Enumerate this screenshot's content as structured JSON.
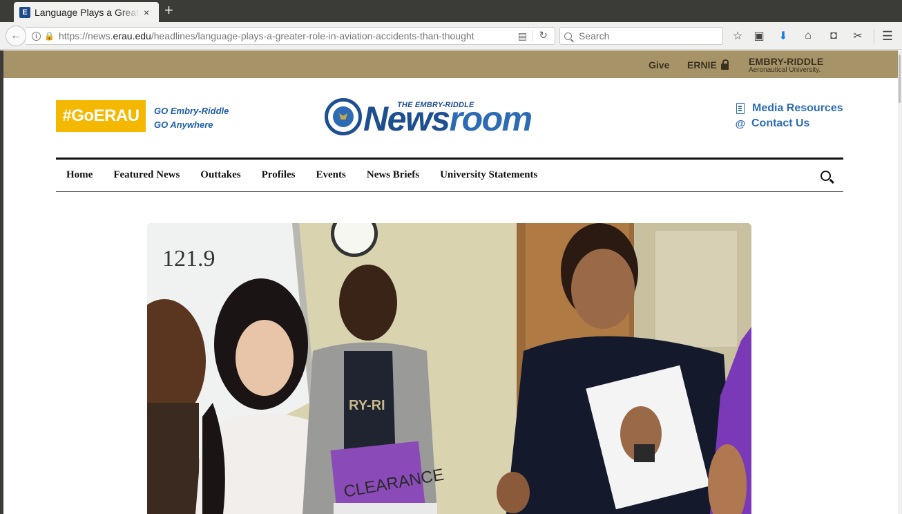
{
  "browser": {
    "tab": {
      "favicon_letter": "E",
      "title": "Language Plays a Greater Role in Aviation Accidents than Thought",
      "close": "×"
    },
    "new_tab": "+",
    "url": {
      "prefix": "https://news.",
      "domain": "erau.edu",
      "path": "/headlines/language-plays-a-greater-role-in-aviation-accidents-than-thought"
    },
    "search_placeholder": "Search",
    "toolbar_icons": [
      "star-icon",
      "library-icon",
      "download-icon",
      "home-icon",
      "pocket-icon",
      "screenshot-icon",
      "menu-icon"
    ]
  },
  "utility": {
    "give": "Give",
    "ernie": "ERNIE",
    "brand_line1": "EMBRY-RIDDLE",
    "brand_line2": "Aeronautical University."
  },
  "header": {
    "goerau_badge": "#GoERAU",
    "go_line1": "GO Embry-Riddle",
    "go_line2": "GO Anywhere",
    "logo_small": "THE EMBRY-RIDDLE",
    "logo_news": "News",
    "logo_room": "room",
    "media_resources": "Media Resources",
    "contact_us": "Contact Us"
  },
  "nav": {
    "items": [
      "Home",
      "Featured News",
      "Outtakes",
      "Profiles",
      "Events",
      "News Briefs",
      "University Statements"
    ]
  },
  "hero": {
    "whiteboard_text": "121.9",
    "sign_text": "CLEARANCE",
    "shirt_text": "RY-RI"
  },
  "colors": {
    "utility_bar": "#a69468",
    "goerau_yellow": "#f5b800",
    "brand_blue": "#1d4f91",
    "link_blue": "#2d6bb5"
  }
}
